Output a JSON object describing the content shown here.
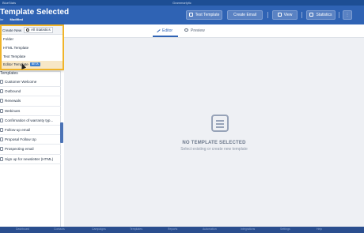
{
  "app": {
    "logo": "BlueStats",
    "center_title": "Grammarlytic"
  },
  "header": {
    "title": "Template Selected",
    "sub_left": "ler",
    "sub_status": "Modified",
    "test_btn": "Test Template",
    "email_btn": "Create Email",
    "view_btn": "View",
    "stats_btn": "Statistics",
    "more_btn": "⋮"
  },
  "sidebar": {
    "search_placeholder": "",
    "gear_label": "⚙ ▾",
    "templates_heading": "Templates",
    "templates": [
      "Customer Welcome",
      "Outbound",
      "Renewals",
      "Webinars",
      "Confirmation of warranty typ...",
      "Follow-up email",
      "Proposal Follow Up",
      "Prospecting email",
      "Sign up for newsletter (HTML)"
    ]
  },
  "dropdown": {
    "create_new": "Create New",
    "all_stats": "All Statistics",
    "items": [
      "Folder",
      "HTML Template",
      "Text Template",
      "Editor Template"
    ],
    "beta_label": "BETA"
  },
  "tabs": {
    "editor": "Editor",
    "preview": "Preview"
  },
  "empty": {
    "title": "NO TEMPLATE SELECTED",
    "subtitle": "Select existing or create new template"
  },
  "footer": [
    "Dashboard",
    "Contacts",
    "Campaigns",
    "Templates",
    "Reports",
    "Automation",
    "Integrations",
    "Settings",
    "Help"
  ]
}
